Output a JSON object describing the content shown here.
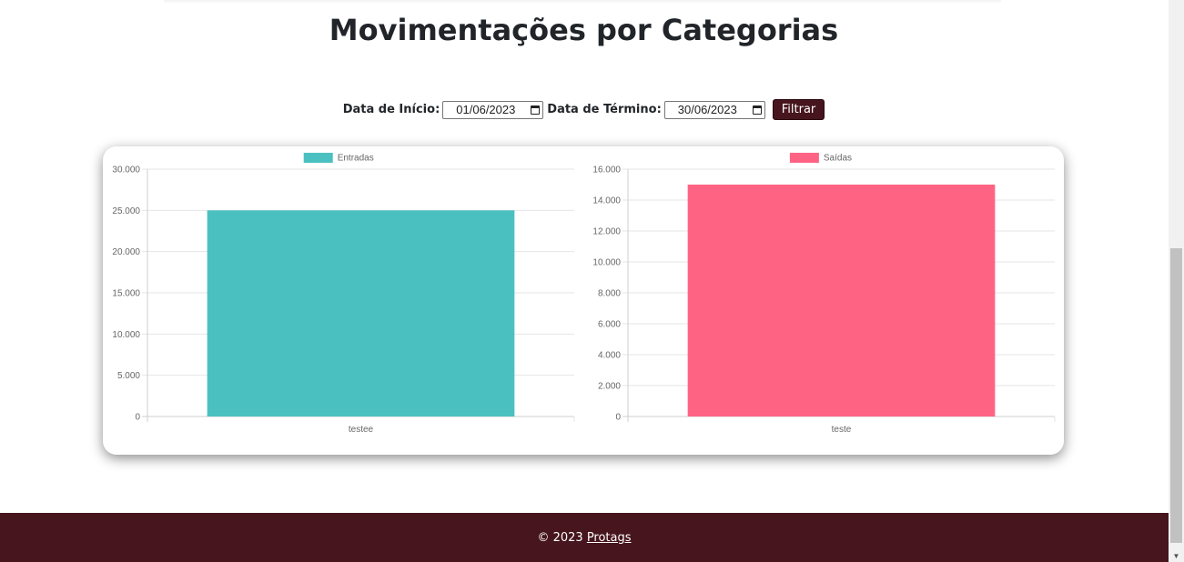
{
  "page": {
    "title": "Movimentações por Categorias"
  },
  "filter": {
    "start_label": "Data de Início:",
    "start_value": "01/06/2023",
    "end_label": "Data de Término:",
    "end_value": "30/06/2023",
    "button_label": "Filtrar"
  },
  "chart_data": [
    {
      "type": "bar",
      "categories": [
        "testee"
      ],
      "series": [
        {
          "name": "Entradas",
          "values": [
            25000
          ],
          "color": "#4bc0c0"
        }
      ],
      "ylim": [
        0,
        30000
      ],
      "yticks": [
        "30.000",
        "25.000",
        "20.000",
        "15.000",
        "10.000",
        "5.000",
        "0"
      ],
      "grid": true,
      "legend": "top"
    },
    {
      "type": "bar",
      "categories": [
        "teste"
      ],
      "series": [
        {
          "name": "Saídas",
          "values": [
            15000
          ],
          "color": "#ff6384"
        }
      ],
      "ylim": [
        0,
        16000
      ],
      "yticks": [
        "16.000",
        "14.000",
        "12.000",
        "10.000",
        "8.000",
        "6.000",
        "4.000",
        "2.000",
        "0"
      ],
      "grid": true,
      "legend": "top"
    }
  ],
  "footer": {
    "copyright": "© 2023",
    "link_label": "Protags"
  }
}
